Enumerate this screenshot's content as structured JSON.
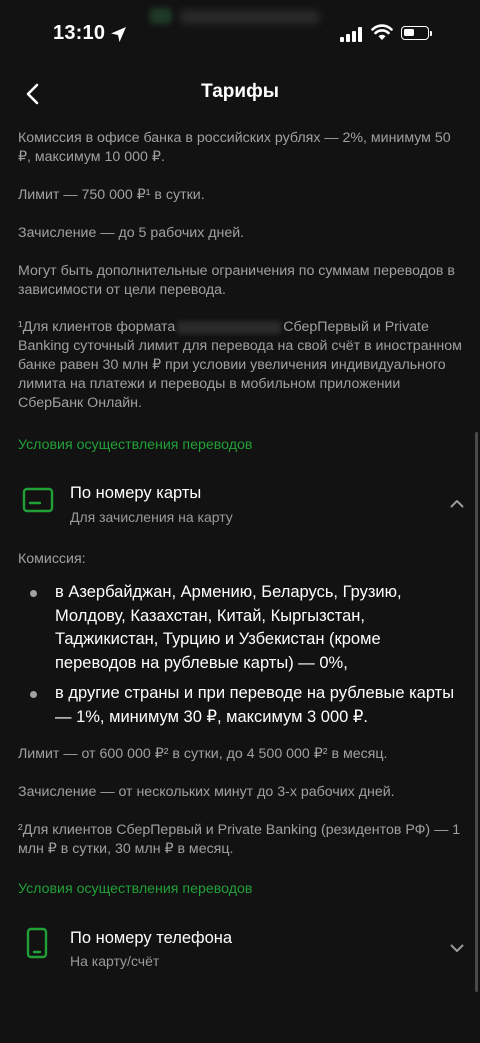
{
  "status_bar": {
    "time": "13:10"
  },
  "header": {
    "title": "Тарифы"
  },
  "intro": {
    "commission": "Комиссия в офисе банка в российских рублях — 2%, минимум 50 ₽, максимум 10 000 ₽.",
    "limit": "Лимит — 750 000 ₽¹ в сутки.",
    "crediting": "Зачисление — до 5 рабочих дней.",
    "restrictions": "Могут быть дополнительные ограничения по суммам переводов в зависимости от цели перевода.",
    "footnote_start": "¹Для клиентов формата",
    "footnote_rest_line1": "СберПервый и Private",
    "footnote_rest": "Banking суточный лимит для перевода на свой счёт в иностранном банке равен 30 млн ₽ при условии увеличения индивидуального лимита на платежи и переводы в мобильном приложении СберБанк Онлайн."
  },
  "section1": {
    "title": "Условия осуществления переводов",
    "method_title": "По номеру карты",
    "method_subtitle": "Для зачисления на карту",
    "commission_label": "Комиссия:",
    "bullets": [
      "в Азербайджан, Армению, Беларусь, Грузию, Молдову, Казахстан, Китай, Кыргызстан, Таджикистан, Турцию и Узбекистан (кроме переводов на рублевые карты) — 0%,",
      "в другие страны и при переводе на рублевые карты — 1%, минимум 30 ₽, максимум 3 000 ₽."
    ],
    "limit": "Лимит — от 600 000 ₽² в сутки, до 4 500 000 ₽² в месяц.",
    "crediting": "Зачисление — от нескольких минут до 3-х рабочих дней.",
    "footnote": "²Для клиентов СберПервый и Private Banking (резидентов РФ) — 1 млн ₽ в сутки, 30 млн ₽ в месяц."
  },
  "section2": {
    "title": "Условия осуществления переводов",
    "method_title": "По номеру телефона",
    "method_subtitle": "На карту/счёт"
  },
  "colors": {
    "background": "#121212",
    "accent_green": "#21a038",
    "text_secondary": "#a0a0a0"
  },
  "icons": [
    "location-arrow-icon",
    "signal-icon",
    "wifi-icon",
    "battery-icon",
    "back-chevron-icon",
    "card-icon",
    "chevron-up-icon",
    "phone-icon",
    "chevron-down-icon"
  ]
}
